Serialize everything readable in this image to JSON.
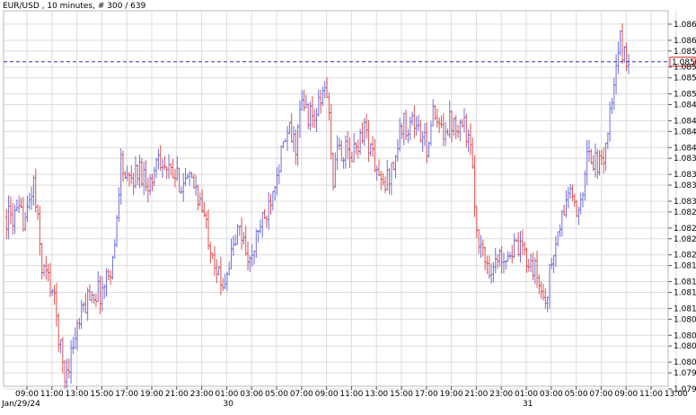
{
  "chart_title": "EUR/USD , 10 minutes, # 300 / 639",
  "colors": {
    "up": "#6f6fe0",
    "down": "#e05050",
    "neutral": "#222222",
    "grid": "#dcdcdc",
    "price_line": "#3333aa",
    "price_box": "#e02020"
  },
  "chart_data": {
    "type": "ohlc",
    "title": "EUR/USD , 10 minutes, # 300 / 639",
    "y_axis": {
      "min": 1.07955,
      "max": 1.08655,
      "ticks": [
        "1.0863",
        "1.0860",
        "1.0858",
        "1.0855",
        "1.0853",
        "1.0850",
        "1.0848",
        "1.0845",
        "1.0843",
        "1.0840",
        "1.0838",
        "1.0835",
        "1.0833",
        "1.0830",
        "1.0828",
        "1.0825",
        "1.0823",
        "1.0820",
        "1.0818",
        "1.0815",
        "1.0813",
        "1.0810",
        "1.0808",
        "1.0805",
        "1.0803",
        "1.0800",
        "1.0798",
        "1.0795"
      ],
      "position": "right"
    },
    "x_axis": {
      "time_labels": [
        "09:00",
        "11:00",
        "13:00",
        "15:00",
        "17:00",
        "19:00",
        "21:00",
        "23:00",
        "01:00",
        "03:00",
        "05:00",
        "07:00",
        "09:00",
        "11:00",
        "13:00",
        "15:00",
        "17:00",
        "19:00",
        "21:00",
        "23:00",
        "01:00",
        "03:00",
        "05:00",
        "07:00",
        "09:00",
        "11:00",
        "13:00"
      ],
      "date_labels": [
        {
          "label": "Jan/29/24",
          "after_time_index": 0
        },
        {
          "label": "30",
          "after_time_index": 8
        },
        {
          "label": "31",
          "after_time_index": 20
        }
      ]
    },
    "current_price": "1.0856",
    "grid": true,
    "segments": [
      [
        0,
        1.0827
      ],
      [
        0.5,
        1.0834
      ],
      [
        1.2,
        1.0818
      ],
      [
        2.0,
        1.0814
      ],
      [
        2.5,
        1.0806
      ],
      [
        3.0,
        1.0797
      ],
      [
        4.0,
        1.0806
      ],
      [
        5.0,
        1.0813
      ],
      [
        6.0,
        1.0813
      ],
      [
        7.0,
        1.082
      ],
      [
        7.5,
        1.0838
      ],
      [
        8.0,
        1.0833
      ],
      [
        9.0,
        1.0836
      ],
      [
        10.0,
        1.0833
      ],
      [
        10.5,
        1.084
      ],
      [
        11.0,
        1.0836
      ],
      [
        12.0,
        1.0834
      ],
      [
        13.5,
        1.0833
      ],
      [
        14.5,
        1.0824
      ],
      [
        15.0,
        1.082
      ],
      [
        15.5,
        1.0814
      ],
      [
        16.0,
        1.0817
      ],
      [
        17.0,
        1.0825
      ],
      [
        18.0,
        1.0818
      ],
      [
        18.5,
        1.0825
      ],
      [
        19.0,
        1.0826
      ],
      [
        20.0,
        1.0836
      ],
      [
        21.0,
        1.0843
      ],
      [
        21.5,
        1.084
      ],
      [
        22.0,
        1.0848
      ],
      [
        23.0,
        1.0845
      ],
      [
        24.0,
        1.0852
      ],
      [
        24.5,
        1.0834
      ],
      [
        25.0,
        1.084
      ],
      [
        26.0,
        1.0838
      ],
      [
        27.0,
        1.0844
      ],
      [
        28.0,
        1.0836
      ],
      [
        28.5,
        1.0832
      ],
      [
        29.5,
        1.0838
      ],
      [
        30.0,
        1.0844
      ],
      [
        31.0,
        1.0845
      ],
      [
        32.0,
        1.084
      ],
      [
        32.5,
        1.0846
      ],
      [
        33.0,
        1.0843
      ],
      [
        34.0,
        1.0845
      ],
      [
        35.0,
        1.0845
      ],
      [
        35.5,
        1.084
      ],
      [
        36.0,
        1.0826
      ],
      [
        36.5,
        1.082
      ],
      [
        37.0,
        1.0818
      ],
      [
        37.5,
        1.0818
      ],
      [
        38.0,
        1.082
      ],
      [
        39.0,
        1.0821
      ],
      [
        40.0,
        1.082
      ],
      [
        40.5,
        1.0818
      ],
      [
        41.0,
        1.0815
      ],
      [
        41.5,
        1.0811
      ],
      [
        42.0,
        1.0818
      ],
      [
        43.0,
        1.0828
      ],
      [
        43.5,
        1.0833
      ],
      [
        44.0,
        1.0826
      ],
      [
        44.5,
        1.0833
      ],
      [
        45.0,
        1.0839
      ],
      [
        46.0,
        1.0836
      ],
      [
        46.5,
        1.0843
      ],
      [
        47.0,
        1.085
      ],
      [
        47.5,
        1.086
      ],
      [
        48.0,
        1.0856
      ]
    ]
  }
}
